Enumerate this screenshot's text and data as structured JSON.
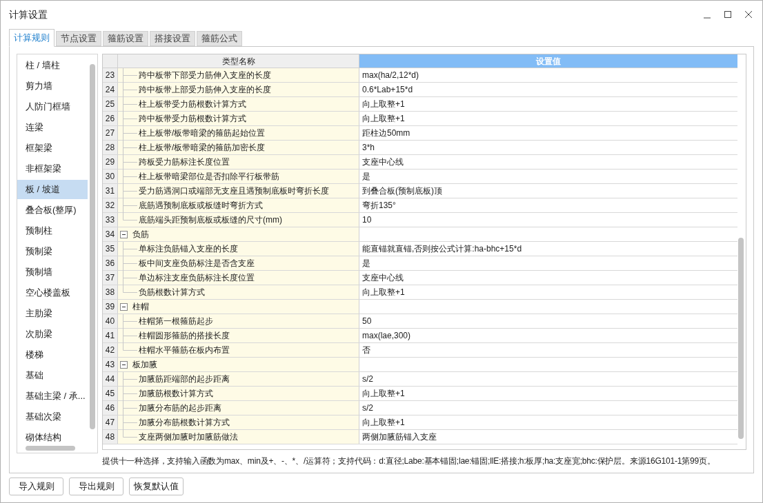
{
  "window": {
    "title": "计算设置"
  },
  "tabs": [
    {
      "label": "计算规则",
      "selected": true
    },
    {
      "label": "节点设置",
      "selected": false
    },
    {
      "label": "箍筋设置",
      "selected": false
    },
    {
      "label": "搭接设置",
      "selected": false
    },
    {
      "label": "箍筋公式",
      "selected": false
    }
  ],
  "sidebar": {
    "items": [
      {
        "label": "柱 / 墙柱",
        "selected": false
      },
      {
        "label": "剪力墙",
        "selected": false
      },
      {
        "label": "人防门框墙",
        "selected": false
      },
      {
        "label": "连梁",
        "selected": false
      },
      {
        "label": "框架梁",
        "selected": false
      },
      {
        "label": "非框架梁",
        "selected": false
      },
      {
        "label": "板 / 坡道",
        "selected": true
      },
      {
        "label": "叠合板(整厚)",
        "selected": false
      },
      {
        "label": "预制柱",
        "selected": false
      },
      {
        "label": "预制梁",
        "selected": false
      },
      {
        "label": "预制墙",
        "selected": false
      },
      {
        "label": "空心楼盖板",
        "selected": false
      },
      {
        "label": "主肋梁",
        "selected": false
      },
      {
        "label": "次肋梁",
        "selected": false
      },
      {
        "label": "楼梯",
        "selected": false
      },
      {
        "label": "基础",
        "selected": false
      },
      {
        "label": "基础主梁 / 承...",
        "selected": false
      },
      {
        "label": "基础次梁",
        "selected": false
      },
      {
        "label": "砌体结构",
        "selected": false
      }
    ]
  },
  "table": {
    "columns": [
      "类型名称",
      "设置值"
    ],
    "rows": [
      {
        "kind": "item",
        "number": "23",
        "name": "跨中板带下部受力筋伸入支座的长度",
        "value": "max(ha/2,12*d)"
      },
      {
        "kind": "item",
        "number": "24",
        "name": "跨中板带上部受力筋伸入支座的长度",
        "value": "0.6*Lab+15*d"
      },
      {
        "kind": "item",
        "number": "25",
        "name": "柱上板带受力筋根数计算方式",
        "value": "向上取整+1"
      },
      {
        "kind": "item",
        "number": "26",
        "name": "跨中板带受力筋根数计算方式",
        "value": "向上取整+1"
      },
      {
        "kind": "item",
        "number": "27",
        "name": "柱上板带/板带暗梁的箍筋起始位置",
        "value": "距柱边50mm"
      },
      {
        "kind": "item",
        "number": "28",
        "name": "柱上板带/板带暗梁的箍筋加密长度",
        "value": "3*h"
      },
      {
        "kind": "item",
        "number": "29",
        "name": "跨板受力筋标注长度位置",
        "value": "支座中心线"
      },
      {
        "kind": "item",
        "number": "30",
        "name": "柱上板带暗梁部位是否扣除平行板带筋",
        "value": "是"
      },
      {
        "kind": "item",
        "number": "31",
        "name": "受力筋遇洞口或端部无支座且遇预制底板时弯折长度",
        "value": "到叠合板(预制底板)顶"
      },
      {
        "kind": "item",
        "number": "32",
        "name": "底筋遇预制底板或板缝时弯折方式",
        "value": "弯折135°"
      },
      {
        "kind": "item",
        "number": "33",
        "name": "底筋端头距预制底板或板缝的尺寸(mm)",
        "value": "10"
      },
      {
        "kind": "group",
        "number": "34",
        "name": "负筋",
        "expanded": true
      },
      {
        "kind": "item",
        "number": "35",
        "name": "单标注负筋锚入支座的长度",
        "value": "能直锚就直锚,否则按公式计算:ha-bhc+15*d"
      },
      {
        "kind": "item",
        "number": "36",
        "name": "板中间支座负筋标注是否含支座",
        "value": "是"
      },
      {
        "kind": "item",
        "number": "37",
        "name": "单边标注支座负筋标注长度位置",
        "value": "支座中心线"
      },
      {
        "kind": "item",
        "number": "38",
        "name": "负筋根数计算方式",
        "value": "向上取整+1"
      },
      {
        "kind": "group",
        "number": "39",
        "name": "柱帽",
        "expanded": true
      },
      {
        "kind": "item",
        "number": "40",
        "name": "柱帽第一根箍筋起步",
        "value": "50"
      },
      {
        "kind": "item",
        "number": "41",
        "name": "柱帽圆形箍筋的搭接长度",
        "value": "max(lae,300)"
      },
      {
        "kind": "item",
        "number": "42",
        "name": "柱帽水平箍筋在板内布置",
        "value": "否"
      },
      {
        "kind": "group",
        "number": "43",
        "name": "板加腋",
        "expanded": true
      },
      {
        "kind": "item",
        "number": "44",
        "name": "加腋筋距端部的起步距离",
        "value": "s/2"
      },
      {
        "kind": "item",
        "number": "45",
        "name": "加腋筋根数计算方式",
        "value": "向上取整+1"
      },
      {
        "kind": "item",
        "number": "46",
        "name": "加腋分布筋的起步距离",
        "value": "s/2"
      },
      {
        "kind": "item",
        "number": "47",
        "name": "加腋分布筋根数计算方式",
        "value": "向上取整+1"
      },
      {
        "kind": "item",
        "number": "48",
        "name": "支座两侧加腋时加腋筋做法",
        "value": "两侧加腋筋锚入支座"
      }
    ]
  },
  "hint": "提供十一种选择，支持输入函数为max、min及+、-、*、/运算符；支持代码：d:直径;Labe:基本锚固;lae:锚固;llE:搭接;h:板厚;ha:支座宽;bhc:保护层。来源16G101-1第99页。",
  "buttons": [
    "导入规则",
    "导出规则",
    "恢复默认值"
  ]
}
